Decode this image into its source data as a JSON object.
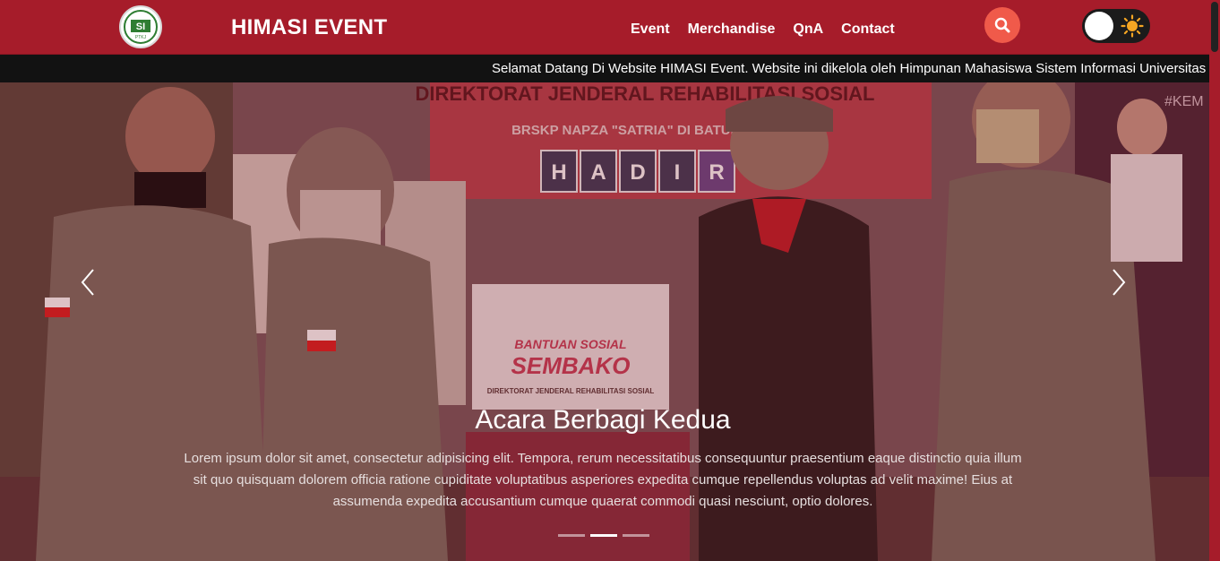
{
  "header": {
    "brand": "HIMASI EVENT",
    "nav": [
      "Event",
      "Merchandise",
      "QnA",
      "Contact"
    ],
    "logo_text": "SI",
    "logo_subtext": "PTKJ"
  },
  "announcement": "Selamat Datang Di Website HIMASI Event. Website ini dikelola oleh Himpunan Mahasiswa Sistem Informasi Universitas",
  "slide": {
    "title": "Acara Berbagi Kedua",
    "text": "Lorem ipsum dolor sit amet, consectetur adipisicing elit. Tempora, rerum necessitatibus consequuntur praesentium eaque distinctio quia illum sit quo quisquam dolorem officia ratione cupiditate voluptatibus asperiores expedita cumque repellendus voluptas ad velit maxime! Eius at assumenda expedita accusantium cumque quaerat commodi quasi nesciunt, optio dolores.",
    "banner_line1": "DIREKTORAT JENDERAL REHABILITASI SOSIAL",
    "banner_line2": "BRSKP NAPZA \"SATRIA\" DI BATURADEN",
    "banner_tiles": [
      "H",
      "A",
      "D",
      "I",
      "R"
    ],
    "box_line1": "BANTUAN SOSIAL",
    "box_line2": "SEMBAKO",
    "box_line3": "DIREKTORAT JENDERAL REHABILITASI SOSIAL",
    "hashtag": "#KEM",
    "indicator_count": 3,
    "active_indicator": 2
  },
  "colors": {
    "navbar": "#a61c2a",
    "search": "#f05a4a",
    "marquee_bg": "#121212"
  },
  "icons": {
    "search": "search-icon",
    "toggle": "sun-icon",
    "prev": "chevron-left-icon",
    "next": "chevron-right-icon"
  }
}
